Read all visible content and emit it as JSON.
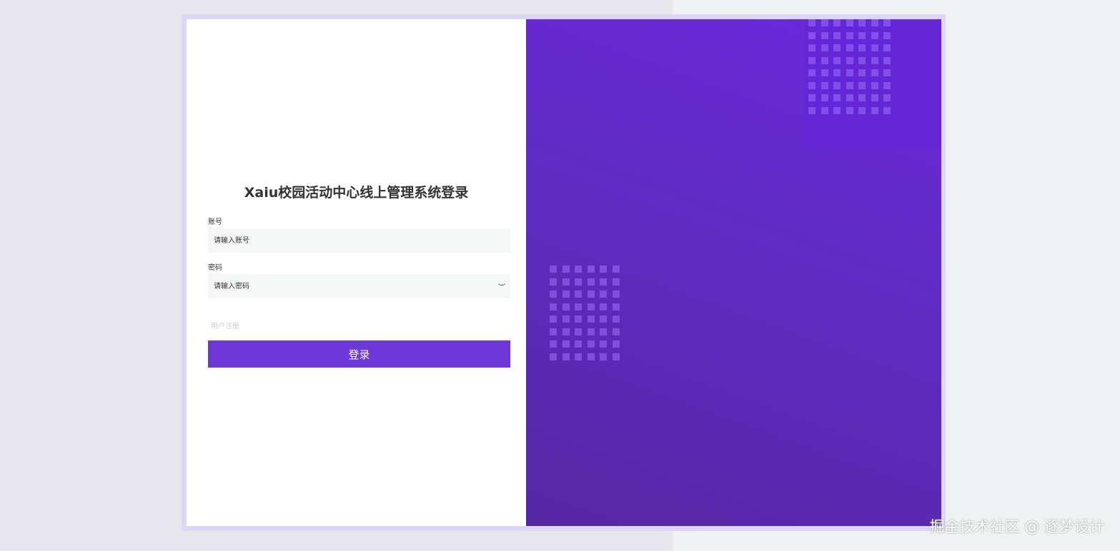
{
  "title": "Xaiu校园活动中心线上管理系统登录",
  "account": {
    "label": "账号",
    "placeholder": "请输入账号"
  },
  "password": {
    "label": "密码",
    "placeholder": "请输入密码"
  },
  "register_link": "用户注册",
  "login_button": "登录",
  "watermark": "掘金技术社区 @ 逐梦设计"
}
